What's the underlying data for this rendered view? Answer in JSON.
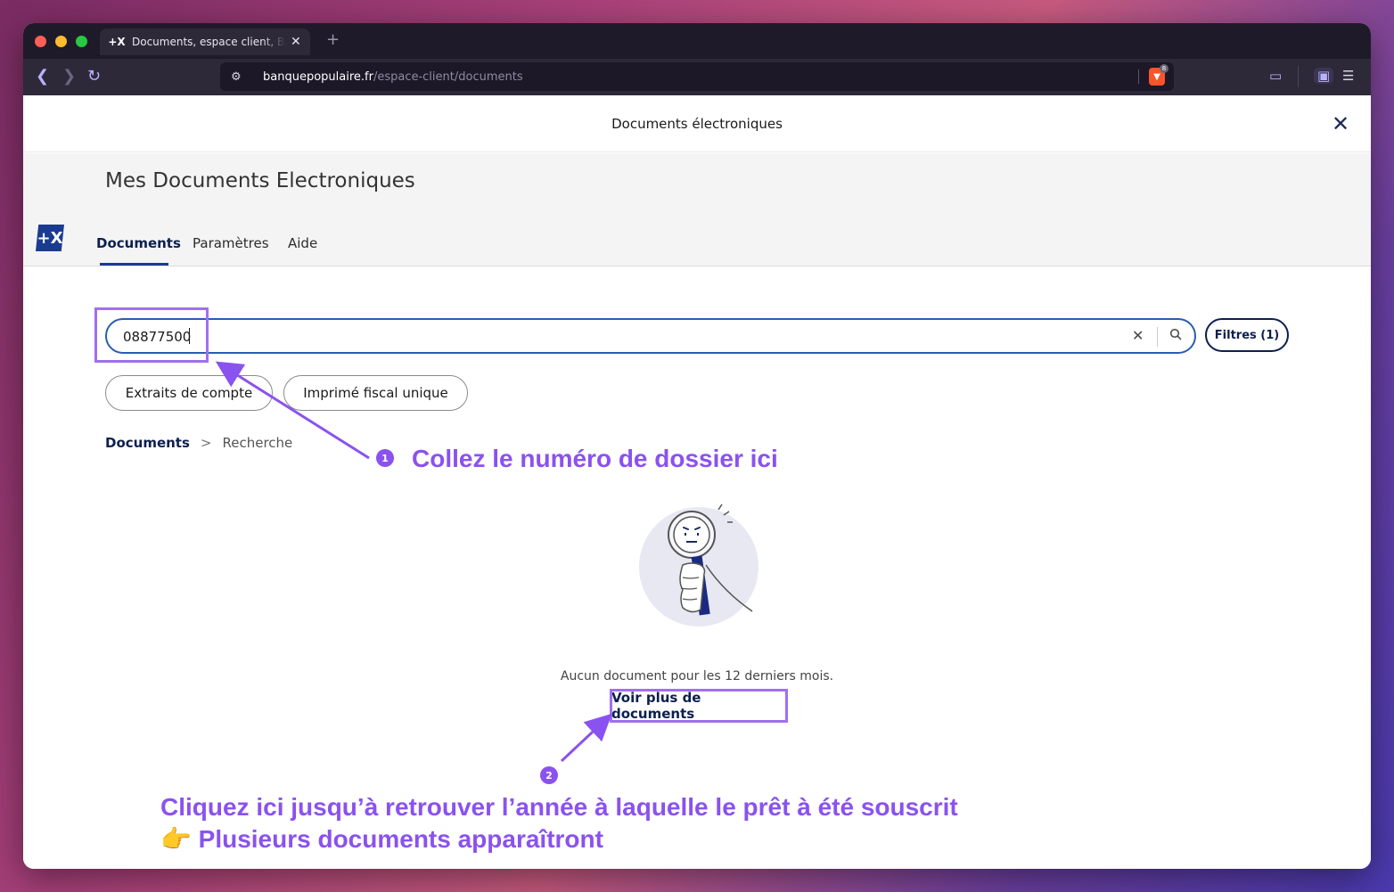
{
  "browser": {
    "tab_title": "Documents, espace client, Banque Populaire",
    "tab_favicon": "+X",
    "new_tab": "+",
    "url_host": "banquepopulaire.fr",
    "url_path": "/espace-client/documents",
    "brave_badge": "8"
  },
  "topbar": {
    "title": "Documents électroniques",
    "close": "✕"
  },
  "header": {
    "page_title": "Mes Documents Electroniques",
    "logo": "+X",
    "tabs": [
      {
        "label": "Documents"
      },
      {
        "label": "Paramètres"
      },
      {
        "label": "Aide"
      }
    ]
  },
  "search": {
    "value": "08877500",
    "clear": "✕",
    "icon": "⚲",
    "filter_label": "Filtres (1)"
  },
  "chips": [
    {
      "label": "Extraits de compte"
    },
    {
      "label": "Imprimé fiscal unique"
    }
  ],
  "breadcrumb": {
    "root": "Documents",
    "sep": ">",
    "current": "Recherche"
  },
  "empty": {
    "message": "Aucun document pour les 12 derniers mois.",
    "more_link": "Voir plus de documents"
  },
  "annotations": {
    "badge1": "1",
    "badge2": "2",
    "step1": "Collez le numéro de dossier ici",
    "step2_line1": "Cliquez ici jusqu’à retrouver l’année à laquelle le prêt à été souscrit",
    "step2_line2": "👉 Plusieurs documents apparaîtront",
    "color": "#8a52ef"
  },
  "colors": {
    "accent": "#1a3b8f",
    "navy": "#0d1f4f",
    "annotation": "#a070f0"
  }
}
